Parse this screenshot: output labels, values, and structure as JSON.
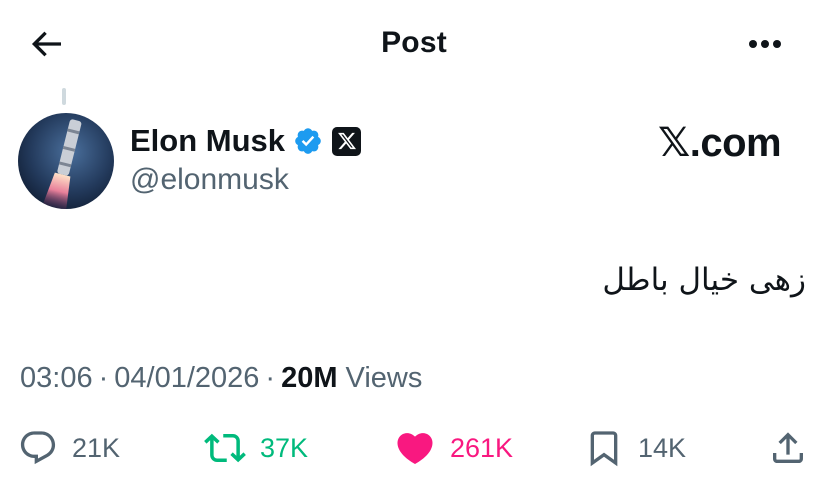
{
  "header": {
    "title": "Post",
    "back_icon": "arrow-left-icon",
    "more_icon": "more-horizontal-icon"
  },
  "author": {
    "display_name": "Elon Musk",
    "handle": "@elonmusk",
    "verified_icon": "verified-badge-icon",
    "affiliation_icon": "x-logo-icon",
    "verified_color": "#1d9bf0"
  },
  "watermark": "𝕏.com",
  "post": {
    "text": "زهی خیال باطل"
  },
  "meta": {
    "time": "03:06",
    "date": "04/01/2026",
    "separator": "·",
    "views_count": "20M",
    "views_label": "Views"
  },
  "actions": {
    "reply": {
      "icon": "reply-icon",
      "count": "21K"
    },
    "repost": {
      "icon": "repost-icon",
      "count": "37K",
      "color": "#00ba7c"
    },
    "like": {
      "icon": "heart-icon",
      "count": "261K",
      "color": "#f91880",
      "active": true
    },
    "bookmark": {
      "icon": "bookmark-icon",
      "count": "14K"
    },
    "share": {
      "icon": "share-icon"
    }
  }
}
